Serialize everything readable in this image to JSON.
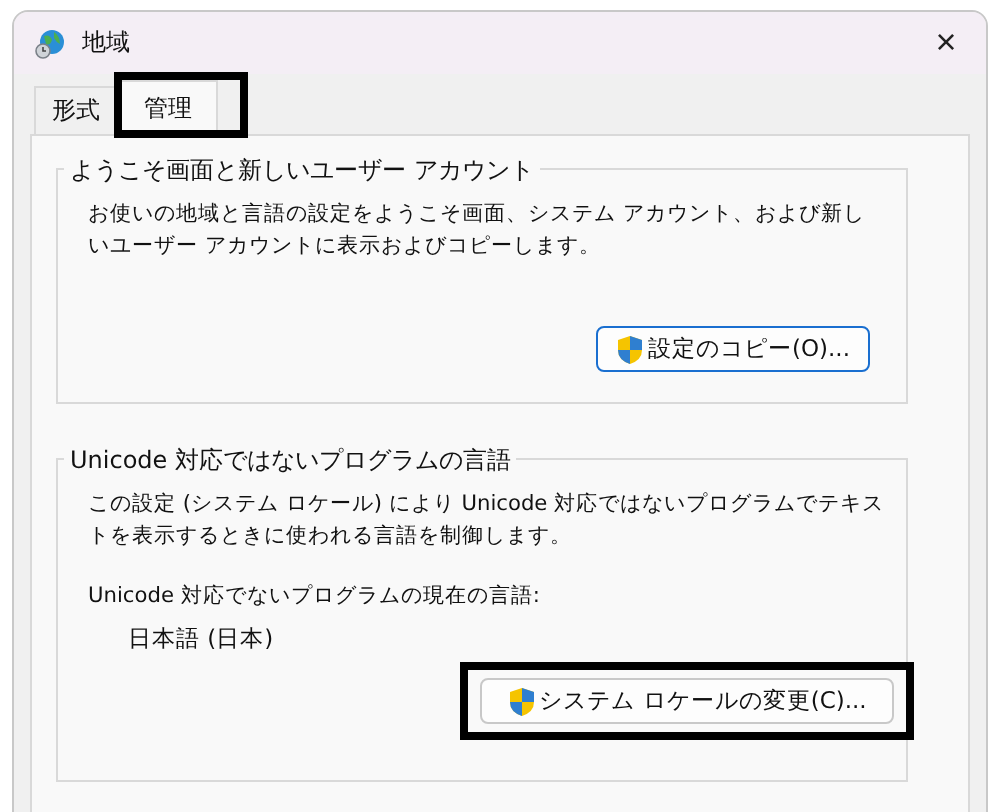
{
  "window": {
    "title": "地域",
    "close": "×"
  },
  "tabs": [
    {
      "label": "形式",
      "selected": false,
      "highlighted": false
    },
    {
      "label": "管理",
      "selected": true,
      "highlighted": true
    }
  ],
  "groups": [
    {
      "title": "ようこそ画面と新しいユーザー アカウント",
      "lines": [
        "お使いの地域と言語の設定をようこそ画面、システム アカウント、および新しいユーザー アカウントに表示およびコピーします。"
      ],
      "button": {
        "label": "設定のコピー(O)...",
        "default": true,
        "highlighted": false
      }
    },
    {
      "title": "Unicode 対応ではないプログラムの言語",
      "lines": [
        "この設定 (システム ロケール) により Unicode 対応ではないプログラムでテキストを表示するときに使われる言語を制御します。",
        "Unicode 対応でないプログラムの現在の言語:"
      ],
      "value": "日本語 (日本)",
      "button": {
        "label": "システム ロケールの変更(C)...",
        "default": false,
        "highlighted": true
      }
    }
  ]
}
